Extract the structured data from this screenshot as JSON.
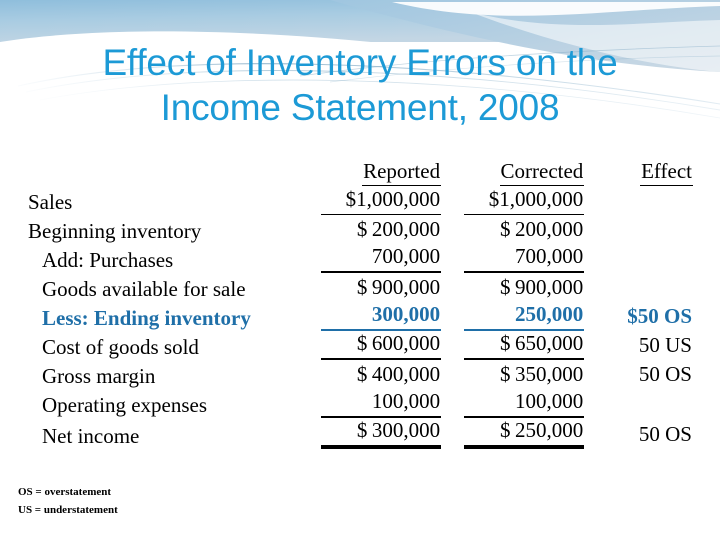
{
  "slide": {
    "title_line1": "Effect of Inventory Errors on the",
    "title_line2": "Income Statement, 2008",
    "title_color": "#1C9AD6",
    "highlight_color": "#1F6FA8",
    "background": "#FFFFFF"
  },
  "table": {
    "columns": {
      "label": "",
      "reported": "Reported",
      "corrected": "Corrected",
      "effect": "Effect"
    },
    "rows": [
      {
        "label": "Sales",
        "reported": "$1,000,000",
        "corrected": "$1,000,000",
        "effect": "",
        "rule": "thin",
        "highlight": false,
        "indent": 0
      },
      {
        "label": "Beginning inventory",
        "reported_sym": "$",
        "reported": "200,000",
        "corrected_sym": "$",
        "corrected": "200,000",
        "effect": "",
        "rule": "none",
        "highlight": false,
        "indent": 0
      },
      {
        "label": "Add: Purchases",
        "reported_sym": "",
        "reported": "700,000",
        "corrected_sym": "",
        "corrected": "700,000",
        "effect": "",
        "rule": "med",
        "highlight": false,
        "indent": 1
      },
      {
        "label": "Goods available for sale",
        "reported_sym": "$",
        "reported": "900,000",
        "corrected_sym": "$",
        "corrected": "900,000",
        "effect": "",
        "rule": "none",
        "highlight": false,
        "indent": 1
      },
      {
        "label": "Less: Ending inventory",
        "reported_sym": "",
        "reported": "300,000",
        "corrected_sym": "",
        "corrected": "250,000",
        "effect": "$50 OS",
        "rule": "blue",
        "highlight": true,
        "indent": 1
      },
      {
        "label": "Cost of goods sold",
        "reported_sym": "$",
        "reported": "600,000",
        "corrected_sym": "$",
        "corrected": "650,000",
        "effect": "50 US",
        "rule": "med",
        "highlight": false,
        "indent": 1
      },
      {
        "label": "Gross margin",
        "reported_sym": "$",
        "reported": "400,000",
        "corrected_sym": "$",
        "corrected": "350,000",
        "effect": "50 OS",
        "rule": "none",
        "highlight": false,
        "indent": 1
      },
      {
        "label": "Operating expenses",
        "reported_sym": "",
        "reported": "100,000",
        "corrected_sym": "",
        "corrected": "100,000",
        "effect": "",
        "rule": "med",
        "highlight": false,
        "indent": 1
      },
      {
        "label": "Net income",
        "reported_sym": "$",
        "reported": "300,000",
        "corrected_sym": "$",
        "corrected": "250,000",
        "effect": "50 OS",
        "rule": "double",
        "highlight": false,
        "indent": 1
      }
    ]
  },
  "notes": [
    "OS = overstatement",
    "US = understatement"
  ]
}
